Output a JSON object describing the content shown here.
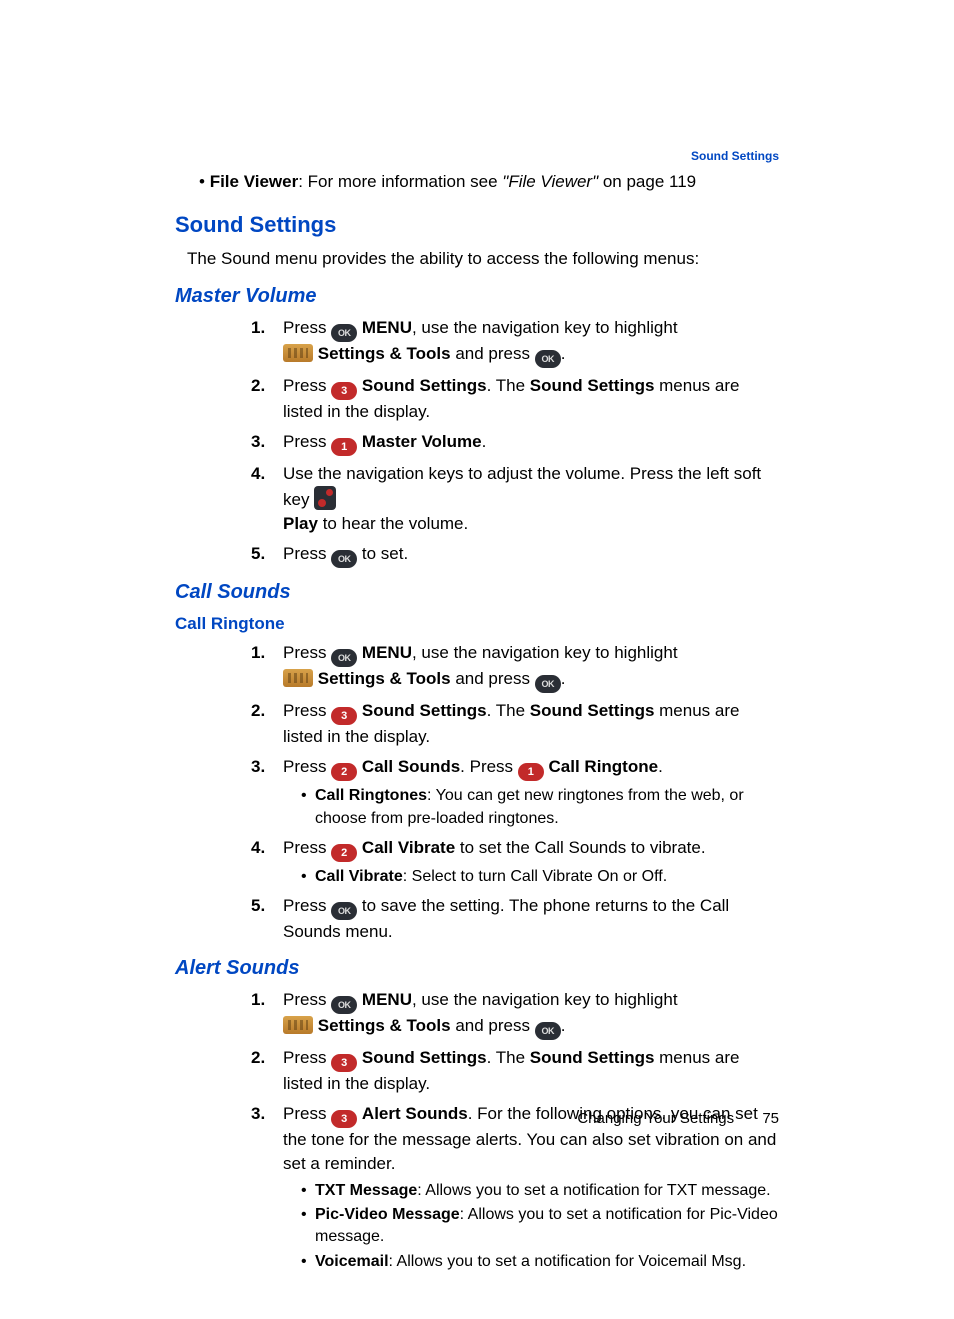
{
  "header": {
    "section": "Sound Settings"
  },
  "top_bullet": {
    "bold": "File Viewer",
    "text": ": For more information see ",
    "ref_italic": "\"File Viewer\"",
    "ref_tail": " on page 119"
  },
  "h1": "Sound Settings",
  "intro": "The Sound menu provides the ability to access the following menus:",
  "master_volume": {
    "title": "Master Volume",
    "steps": {
      "s1a": "Press ",
      "s1b": "MENU",
      "s1c": ", use the navigation key to highlight ",
      "s1d": "Settings & Tools",
      "s1e": " and press ",
      "s2a": "Press ",
      "s2b": "Sound Settings",
      "s2c": ". The ",
      "s2d": "Sound Settings",
      "s2e": " menus are listed in the display.",
      "s3a": "Press ",
      "s3b": "Master Volume",
      "s3c": ".",
      "s4a": "Use the navigation keys to adjust the volume. Press the left soft key ",
      "s4b": "Play",
      "s4c": " to hear the volume.",
      "s5a": "Press ",
      "s5b": " to set."
    }
  },
  "call_sounds": {
    "title": "Call Sounds",
    "subtitle": "Call Ringtone",
    "steps": {
      "s1a": "Press ",
      "s1b": "MENU",
      "s1c": ", use the navigation key to highlight ",
      "s1d": "Settings & Tools",
      "s1e": " and press ",
      "s2a": "Press ",
      "s2b": "Sound Settings",
      "s2c": ". The ",
      "s2d": "Sound Settings",
      "s2e": " menus are listed in the display.",
      "s3a": "Press ",
      "s3b": "Call Sounds",
      "s3c": ". Press ",
      "s3d": "Call Ringtone",
      "s3e": ".",
      "s3sub_b": "Call Ringtones",
      "s3sub_t": ": You can get new ringtones from the web, or choose from pre-loaded ringtones.",
      "s4a": "Press ",
      "s4b": "Call Vibrate",
      "s4c": " to set the Call Sounds to vibrate.",
      "s4sub_b": "Call Vibrate",
      "s4sub_t": ": Select to turn Call Vibrate On or Off.",
      "s5a": "Press ",
      "s5b": " to save the setting. The phone returns to the Call Sounds menu."
    }
  },
  "alert_sounds": {
    "title": "Alert Sounds",
    "steps": {
      "s1a": "Press ",
      "s1b": "MENU",
      "s1c": ", use the navigation key to highlight ",
      "s1d": "Settings & Tools",
      "s1e": " and press ",
      "s2a": "Press ",
      "s2b": "Sound Settings",
      "s2c": ". The ",
      "s2d": "Sound Settings",
      "s2e": " menus are listed in the display.",
      "s3a": "Press ",
      "s3b": "Alert Sounds",
      "s3c": ". For the following options, you can set the tone for the message alerts. You can also set vibration on and set a reminder.",
      "sub1_b": "TXT Message",
      "sub1_t": ": Allows you to set a notification for TXT message.",
      "sub2_b": "Pic-Video Message",
      "sub2_t": ": Allows you to set a notification for Pic-Video message.",
      "sub3_b": "Voicemail",
      "sub3_t": ": Allows you to set a notification for Voicemail Msg."
    }
  },
  "footer": {
    "chapter": "Changing Your Settings",
    "page": "75"
  },
  "nums": {
    "one": "1",
    "two": "2",
    "three": "3"
  }
}
